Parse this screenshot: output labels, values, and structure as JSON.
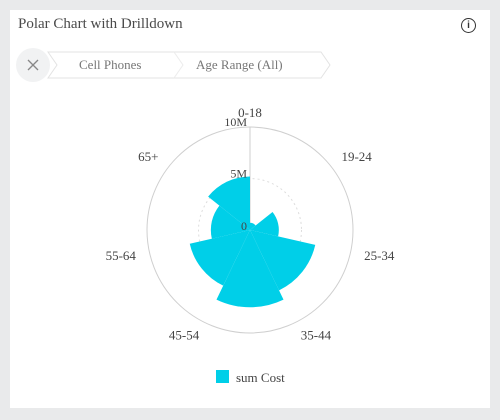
{
  "header": {
    "title": "Polar Chart with Drilldown",
    "info_icon": "info-icon",
    "info_glyph": "i"
  },
  "breadcrumb": {
    "close_icon": "close-icon",
    "items": [
      "Cell Phones",
      "Age Range (All)"
    ]
  },
  "colors": {
    "series": "#00cfe8",
    "grid": "#cfcfcf",
    "text": "#444444"
  },
  "chart_data": {
    "type": "polar-bar",
    "categories": [
      "0-18",
      "19-24",
      "25-34",
      "35-44",
      "45-54",
      "55-64",
      "65+"
    ],
    "radial_ticks": [
      "0",
      "5M",
      "10M"
    ],
    "rmax": 10000000,
    "series": [
      {
        "name": "sum Cost",
        "values": [
          700000,
          2800000,
          6500000,
          7500000,
          6000000,
          3800000,
          5200000
        ]
      }
    ],
    "legend": "bottom"
  }
}
